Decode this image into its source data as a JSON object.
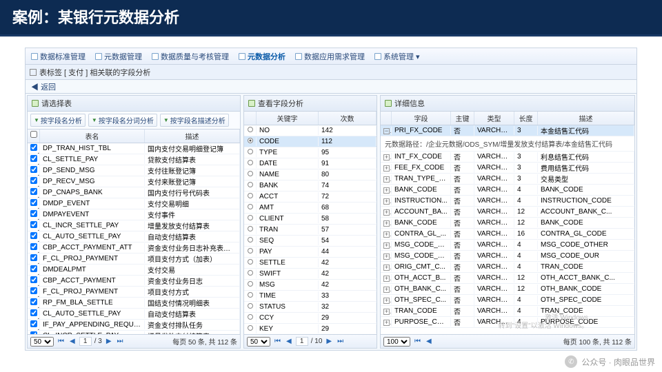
{
  "slide": {
    "title": "案例：某银行元数据分析"
  },
  "menu": {
    "items": [
      "数据标准管理",
      "元数据管理",
      "数据质量与考核管理",
      "元数据分析",
      "数据应用需求管理",
      "系统管理"
    ],
    "active": 3
  },
  "tab": {
    "title": "表标签 [ 支付 ] 相关联的字段分析"
  },
  "back": "返回",
  "left": {
    "title": "请选择表",
    "btns": [
      "按字段名分析",
      "按字段名分词分析",
      "按字段名描述分析"
    ],
    "cols": [
      "表名",
      "描述"
    ],
    "rows": [
      {
        "n": "DP_TRAN_HIST_TBL",
        "d": "国内支付交易明细登记簿"
      },
      {
        "n": "CL_SETTLE_PAY",
        "d": "贷款支付结算表"
      },
      {
        "n": "DP_SEND_MSG",
        "d": "支付往账登记簿"
      },
      {
        "n": "DP_RECV_MSG",
        "d": "支付来账登记簿"
      },
      {
        "n": "DP_CNAPS_BANK",
        "d": "国内支付行号代码表"
      },
      {
        "n": "DMDP_EVENT",
        "d": "支付交易明细"
      },
      {
        "n": "DMPAYEVENT",
        "d": "支付事件"
      },
      {
        "n": "CL_INCR_SETTLE_PAY",
        "d": "增量发放支付结算表"
      },
      {
        "n": "CL_AUTO_SETTLE_PAY",
        "d": "自动支付结算表"
      },
      {
        "n": "CBP_ACCT_PAYMENT_ATT",
        "d": "资金支付业务日志补充表（核心流…"
      },
      {
        "n": "F_CL_PROJ_PAYMENT",
        "d": "项目支付方式（加表）"
      },
      {
        "n": "DMDEALPMT",
        "d": "支付交易"
      },
      {
        "n": "CBP_ACCT_PAYMENT",
        "d": "资金支付业务日志"
      },
      {
        "n": "F_CL_PROJ_PAYMENT",
        "d": "项目支付方式"
      },
      {
        "n": "RP_FM_BLA_SETTLE",
        "d": "国结支付情况明细表"
      },
      {
        "n": "CL_AUTO_SETTLE_PAY",
        "d": "自动支付结算表"
      },
      {
        "n": "IF_PAY_APPENDING_REQUEST",
        "d": "资金支付排队任务"
      },
      {
        "n": "CL_INCR_SETTLE_PAY",
        "d": "增量发放支付结算表"
      }
    ],
    "pager": {
      "size": "50",
      "page": "1",
      "pages": "3",
      "summary": "每页 50 条, 共 112 条"
    }
  },
  "mid": {
    "title": "查看字段分析",
    "cols": [
      "关键字",
      "次数"
    ],
    "sel": 1,
    "rows": [
      {
        "k": "NO",
        "c": "142"
      },
      {
        "k": "CODE",
        "c": "112"
      },
      {
        "k": "TYPE",
        "c": "95"
      },
      {
        "k": "DATE",
        "c": "91"
      },
      {
        "k": "NAME",
        "c": "80"
      },
      {
        "k": "BANK",
        "c": "74"
      },
      {
        "k": "ACCT",
        "c": "72"
      },
      {
        "k": "AMT",
        "c": "68"
      },
      {
        "k": "CLIENT",
        "c": "58"
      },
      {
        "k": "TRAN",
        "c": "57"
      },
      {
        "k": "SEQ",
        "c": "54"
      },
      {
        "k": "PAY",
        "c": "44"
      },
      {
        "k": "SETTLE",
        "c": "42"
      },
      {
        "k": "SWIFT",
        "c": "42"
      },
      {
        "k": "MSG",
        "c": "42"
      },
      {
        "k": "TIME",
        "c": "33"
      },
      {
        "k": "STATUS",
        "c": "32"
      },
      {
        "k": "CCY",
        "c": "29"
      },
      {
        "k": "KEY",
        "c": "29"
      }
    ],
    "pager": {
      "size": "50",
      "page": "1",
      "pages": "10"
    }
  },
  "right": {
    "title": "详细信息",
    "cols": [
      "字段",
      "主键",
      "类型",
      "长度",
      "描述"
    ],
    "path": "元数据路径：/企业元数据/ODS_SYM/增量发放支付结算表/本金结售汇代码",
    "first": {
      "f": "PRI_FX_CODE",
      "pk": "否",
      "t": "VARCHA...",
      "l": "3",
      "d": "本金结售汇代码"
    },
    "rows": [
      {
        "f": "INT_FX_CODE",
        "pk": "否",
        "t": "VARCHA...",
        "l": "3",
        "d": "利息结售汇代码"
      },
      {
        "f": "FEE_FX_CODE",
        "pk": "否",
        "t": "VARCHA...",
        "l": "3",
        "d": "费用结售汇代码"
      },
      {
        "f": "TRAN_TYPE_C...",
        "pk": "否",
        "t": "VARCHA...",
        "l": "3",
        "d": "交易类型"
      },
      {
        "f": "BANK_CODE",
        "pk": "否",
        "t": "VARCHA...",
        "l": "4",
        "d": "BANK_CODE"
      },
      {
        "f": "INSTRUCTION...",
        "pk": "否",
        "t": "VARCHA...",
        "l": "4",
        "d": "INSTRUCTION_CODE"
      },
      {
        "f": "ACCOUNT_BA...",
        "pk": "否",
        "t": "VARCHA...",
        "l": "12",
        "d": "ACCOUNT_BANK_C..."
      },
      {
        "f": "BANK_CODE",
        "pk": "否",
        "t": "VARCHA...",
        "l": "12",
        "d": "BANK_CODE"
      },
      {
        "f": "CONTRA_GL_...",
        "pk": "否",
        "t": "VARCHA...",
        "l": "16",
        "d": "CONTRA_GL_CODE"
      },
      {
        "f": "MSG_CODE_O...",
        "pk": "否",
        "t": "VARCHA...",
        "l": "4",
        "d": "MSG_CODE_OTHER"
      },
      {
        "f": "MSG_CODE_O...",
        "pk": "否",
        "t": "VARCHA...",
        "l": "4",
        "d": "MSG_CODE_OUR"
      },
      {
        "f": "ORIG_CMT_C...",
        "pk": "否",
        "t": "VARCHA...",
        "l": "4",
        "d": "TRAN_CODE"
      },
      {
        "f": "OTH_ACCT_B...",
        "pk": "否",
        "t": "VARCHA...",
        "l": "12",
        "d": "OTH_ACCT_BANK_C..."
      },
      {
        "f": "OTH_BANK_C...",
        "pk": "否",
        "t": "VARCHA...",
        "l": "12",
        "d": "OTH_BANK_CODE"
      },
      {
        "f": "OTH_SPEC_C...",
        "pk": "否",
        "t": "VARCHA...",
        "l": "4",
        "d": "OTH_SPEC_CODE"
      },
      {
        "f": "TRAN_CODE",
        "pk": "否",
        "t": "VARCHA...",
        "l": "4",
        "d": "TRAN_CODE"
      },
      {
        "f": "PURPOSE_CODE",
        "pk": "否",
        "t": "VARCHA...",
        "l": "4",
        "d": "PURPOSE_CODE"
      }
    ],
    "pager": {
      "size": "100",
      "summary": "每页 100 条, 共 112 条"
    }
  },
  "watermark": {
    "text": "公众号 · 肉眼品世界"
  },
  "winwm": {
    "l1": "激活 Windows",
    "l2": "转到\"设置\"以激活 Windows。"
  }
}
